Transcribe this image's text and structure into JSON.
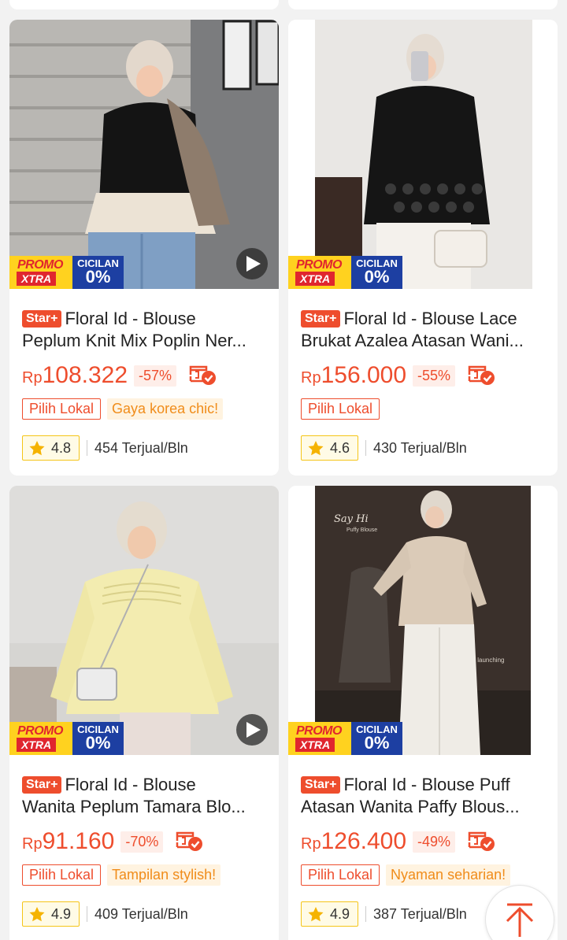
{
  "colors": {
    "accent": "#ee4d2d",
    "feature_tag": "#f08c1a",
    "promo_yellow": "#ffd21f",
    "promo_blue": "#1d3fa2"
  },
  "badges": {
    "promo_line1": "PROMO",
    "promo_line2": "XTRA",
    "cicilan_line1": "CICILAN",
    "cicilan_line2": "0%",
    "star": "Star+"
  },
  "products": [
    {
      "title_line1": "Floral Id - Blouse",
      "title_line2": "Peplum Knit Mix Poplin Ner...",
      "currency": "Rp",
      "price": "108.322",
      "discount": "-57%",
      "tag_lokal": "Pilih Lokal",
      "tag_feature": "Gaya korea chic!",
      "rating": "4.8",
      "sold": "454 Terjual/Bln",
      "has_video": true
    },
    {
      "title_line1": "Floral Id - Blouse Lace",
      "title_line2": "Brukat Azalea Atasan Wani...",
      "currency": "Rp",
      "price": "156.000",
      "discount": "-55%",
      "tag_lokal": "Pilih Lokal",
      "tag_feature": "",
      "rating": "4.6",
      "sold": "430 Terjual/Bln",
      "has_video": false
    },
    {
      "title_line1": "Floral Id - Blouse",
      "title_line2": "Wanita Peplum Tamara Blo...",
      "currency": "Rp",
      "price": "91.160",
      "discount": "-70%",
      "tag_lokal": "Pilih Lokal",
      "tag_feature": "Tampilan stylish!",
      "rating": "4.9",
      "sold": "409 Terjual/Bln",
      "has_video": true
    },
    {
      "title_line1": "Floral Id - Blouse Puff",
      "title_line2": "Atasan Wanita Paffy Blous...",
      "currency": "Rp",
      "price": "126.400",
      "discount": "-49%",
      "tag_lokal": "Pilih Lokal",
      "tag_feature": "Nyaman seharian!",
      "rating": "4.9",
      "sold": "387 Terjual/Bln",
      "has_video": false,
      "photo_text_1": "Say Hi",
      "photo_text_2": "Puffy Blouse",
      "photo_text_3": "New launching"
    }
  ]
}
